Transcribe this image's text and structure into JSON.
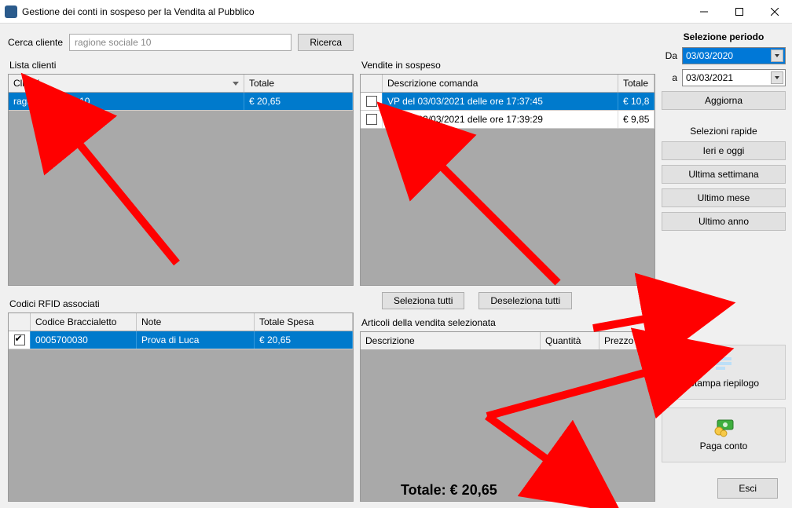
{
  "window": {
    "title": "Gestione dei conti in sospeso per la Vendita al Pubblico"
  },
  "search": {
    "label": "Cerca cliente",
    "value": "ragione sociale 10",
    "button": "Ricerca"
  },
  "clients": {
    "section_label": "Lista clienti",
    "cols": {
      "name": "Clienti",
      "total": "Totale"
    },
    "rows": [
      {
        "name": "ragione sociale 10",
        "total": "€ 20,65",
        "selected": true
      }
    ]
  },
  "rfid": {
    "section_label": "Codici RFID associati",
    "cols": {
      "code": "Codice Braccialetto",
      "note": "Note",
      "total": "Totale Spesa"
    },
    "rows": [
      {
        "checked": true,
        "code": "0005700030",
        "note": "Prova di Luca",
        "total": "€ 20,65",
        "selected": true
      }
    ]
  },
  "sales": {
    "section_label": "Vendite in sospeso",
    "cols": {
      "desc": "Descrizione comanda",
      "total": "Totale"
    },
    "rows": [
      {
        "checked": false,
        "desc": "VP del 03/03/2021 delle ore 17:37:45",
        "total": "€ 10,8",
        "selected": true
      },
      {
        "checked": false,
        "desc": "VP del 03/03/2021 delle ore 17:39:29",
        "total": "€ 9,85",
        "selected": false
      }
    ],
    "select_all": "Seleziona tutti",
    "deselect_all": "Deseleziona tutti"
  },
  "articles": {
    "section_label": "Articoli della vendita selezionata",
    "cols": {
      "desc": "Descrizione",
      "qty": "Quantità",
      "price": "Prezzo"
    }
  },
  "period": {
    "title": "Selezione periodo",
    "from_label": "Da",
    "from_value": "03/03/2020",
    "to_label": "a",
    "to_value": "03/03/2021",
    "refresh": "Aggiorna",
    "quick_title": "Selezioni rapide",
    "quick": {
      "yesterday_today": "Ieri e oggi",
      "last_week": "Ultima settimana",
      "last_month": "Ultimo mese",
      "last_year": "Ultimo anno"
    }
  },
  "actions": {
    "print": "Stampa riepilogo",
    "pay": "Paga conto",
    "exit": "Esci"
  },
  "total": "Totale: € 20,65"
}
